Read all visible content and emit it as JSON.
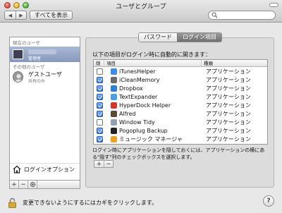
{
  "window": {
    "title": "ユーザとグループ"
  },
  "toolbar": {
    "show_all_label": "すべてを表示",
    "back_glyph": "◀",
    "forward_glyph": "▶"
  },
  "sidebar": {
    "current_users_header": "現在のユーザ",
    "current_user": {
      "role": "管理者"
    },
    "other_users_header": "その他のユーザ",
    "guest": {
      "name": "ゲストユーザ",
      "subtitle": "共有のみ"
    },
    "login_options_label": "ログインオプション",
    "bar": {
      "add": "+",
      "remove": "−",
      "gear_icon": "gear-icon"
    }
  },
  "tabs": [
    {
      "label": "パスワード",
      "active": false
    },
    {
      "label": "ログイン項目",
      "active": true
    }
  ],
  "login_items": {
    "intro": "以下の項目がログイン時に自動的に開きます：",
    "columns": {
      "hide": "隠す",
      "item": "項目",
      "kind": "種類"
    },
    "rows": [
      {
        "checked": false,
        "name": "iTunesHelper",
        "kind": "アプリケーション",
        "icon_color": "#3b8fe8"
      },
      {
        "checked": true,
        "name": "iCleanMemory",
        "kind": "アプリケーション",
        "icon_color": "#6c6c6c"
      },
      {
        "checked": true,
        "name": "Dropbox",
        "kind": "アプリケーション",
        "icon_color": "#2f7ed8"
      },
      {
        "checked": true,
        "name": "TextExpander",
        "kind": "アプリケーション",
        "icon_color": "#4aa0e0"
      },
      {
        "checked": true,
        "name": "HyperDock Helper",
        "kind": "アプリケーション",
        "icon_color": "#d9342b"
      },
      {
        "checked": true,
        "name": "Alfred",
        "kind": "アプリケーション",
        "icon_color": "#5a4a3a"
      },
      {
        "checked": false,
        "name": "Window Tidy",
        "kind": "アプリケーション",
        "icon_color": "#8fa0b8"
      },
      {
        "checked": true,
        "name": "Pogoplug Backup",
        "kind": "アプリケーション",
        "icon_color": "#222222"
      },
      {
        "checked": true,
        "name": "ミュージック マネージャ",
        "kind": "アプリケーション",
        "icon_color": "#f0a020"
      }
    ],
    "note": "ログイン時にアプリケーションを隠しておくには、アプリケーションの横にある\"隠す\"列のチェックボックスを選択します。",
    "bar": {
      "add": "+",
      "remove": "−"
    }
  },
  "footer": {
    "lock_text": "変更できないようにするにはカギをクリックします。",
    "help": "?"
  }
}
